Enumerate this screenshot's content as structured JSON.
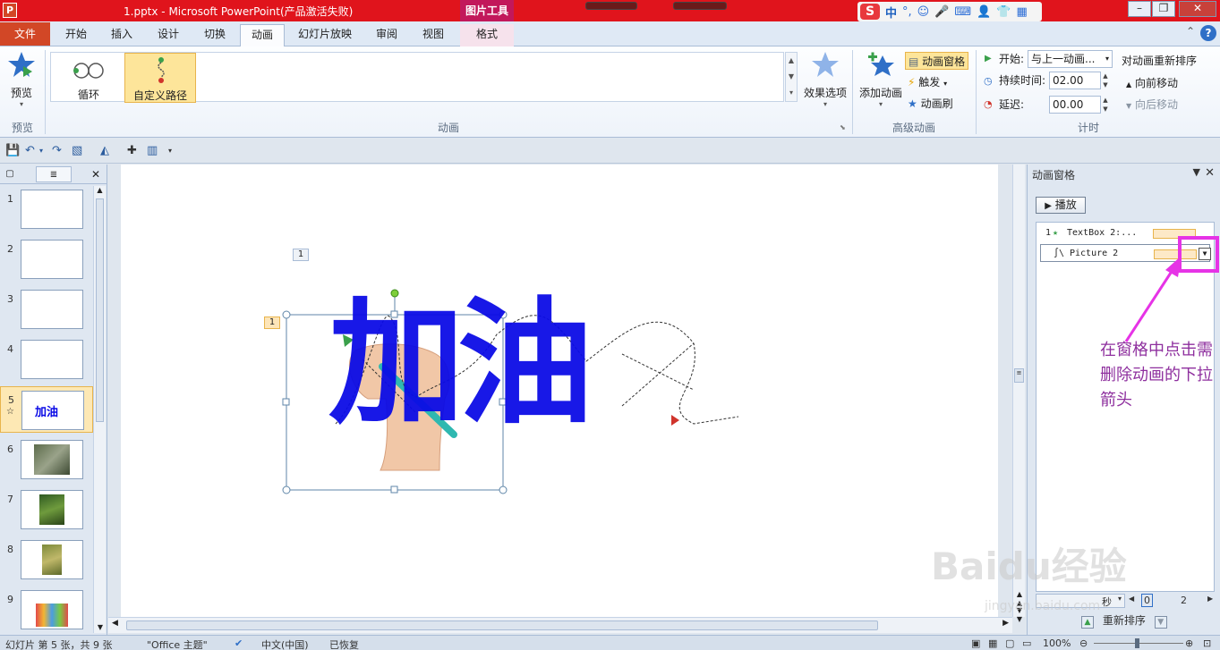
{
  "window": {
    "title": "1.pptx - Microsoft PowerPoint(产品激活失败)",
    "context_tool": "图片工具",
    "ime": "中"
  },
  "tabs": [
    {
      "label": "文件"
    },
    {
      "label": "开始"
    },
    {
      "label": "插入"
    },
    {
      "label": "设计"
    },
    {
      "label": "切换"
    },
    {
      "label": "动画"
    },
    {
      "label": "幻灯片放映"
    },
    {
      "label": "审阅"
    },
    {
      "label": "视图"
    },
    {
      "label": "格式"
    }
  ],
  "ribbon": {
    "preview_label": "预览",
    "preview_group": "预览",
    "gallery": {
      "loop": "循环",
      "custom_path": "自定义路径"
    },
    "animation_group": "动画",
    "effect_options": "效果选项",
    "add_animation": "添加动画",
    "animation_pane": "动画窗格",
    "trigger": "触发",
    "animation_painter": "动画刷",
    "advanced_group": "高级动画",
    "start_label": "开始:",
    "start_value": "与上一动画...",
    "duration_label": "持续时间:",
    "duration_value": "02.00",
    "delay_label": "延迟:",
    "delay_value": "00.00",
    "reorder_title": "对动画重新排序",
    "move_earlier": "向前移动",
    "move_later": "向后移动",
    "timing_group": "计时"
  },
  "slides": [
    {
      "num": "1",
      "kind": "blank"
    },
    {
      "num": "2",
      "kind": "blank"
    },
    {
      "num": "3",
      "kind": "blank"
    },
    {
      "num": "4",
      "kind": "blank"
    },
    {
      "num": "5",
      "kind": "text",
      "text": "加油"
    },
    {
      "num": "6",
      "kind": "photo"
    },
    {
      "num": "7",
      "kind": "photo"
    },
    {
      "num": "8",
      "kind": "photo"
    },
    {
      "num": "9",
      "kind": "photo"
    }
  ],
  "canvas": {
    "main_text": "加油",
    "anim_tag_1": "1",
    "anim_tag_2": "1"
  },
  "anim_pane": {
    "title": "动画窗格",
    "play": "播放",
    "items": [
      {
        "num": "1",
        "label": "TextBox 2:..."
      },
      {
        "num": "",
        "label": "Picture 2"
      }
    ],
    "timeline_unit": "秒",
    "timeline_mark_0": "0",
    "timeline_mark_2": "2",
    "reorder": "重新排序"
  },
  "callout": "在窗格中点击需删除动画的下拉箭头",
  "status": {
    "slide_info": "幻灯片 第 5 张，共 9 张",
    "theme": "\"Office 主题\"",
    "language": "中文(中国)",
    "recovered": "已恢复",
    "zoom": "100%"
  },
  "watermark": "Baidu经验",
  "watermark_url": "jingyan.baidu.com",
  "colors": {
    "title_bar": "#e0141c",
    "file_tab": "#d24726",
    "text_fill": "#0a0ae6",
    "highlight": "#e633e6",
    "callout_text": "#8e2f9e"
  }
}
